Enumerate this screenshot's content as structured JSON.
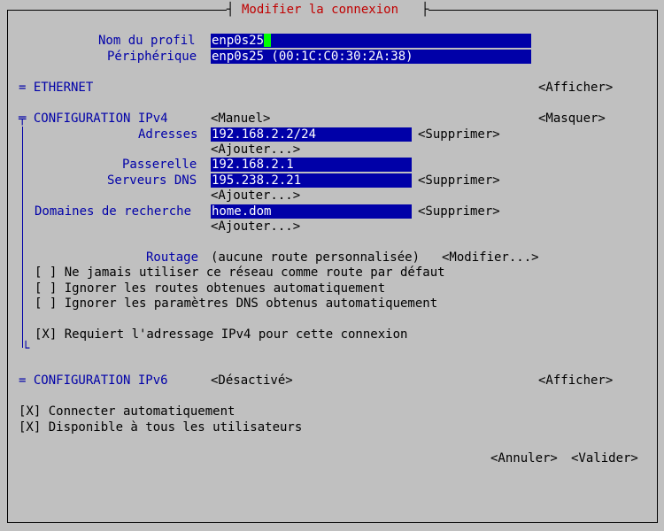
{
  "title": "Modifier la connexion",
  "profile": {
    "label": "Nom du profil",
    "value": "enp0s25"
  },
  "device": {
    "label": "Périphérique",
    "value": "enp0s25 (00:1C:C0:30:2A:38)"
  },
  "ethernet": {
    "header": "= ETHERNET",
    "action": "<Afficher>"
  },
  "ipv4": {
    "header": "╤ CONFIGURATION IPv4",
    "mode": "<Manuel>",
    "action": "<Masquer>",
    "addresses_label": "Adresses",
    "address_value": "192.168.2.2/24",
    "gateway_label": "Passerelle",
    "gateway_value": "192.168.2.1",
    "dns_label": "Serveurs DNS",
    "dns_value": "195.238.2.21",
    "search_label": "Domaines de recherche",
    "search_value": "home.dom",
    "remove": "<Supprimer>",
    "add": "<Ajouter...>",
    "routing_label": "Routage",
    "routing_value": "(aucune route personnalisée)",
    "routing_action": "<Modifier...>",
    "checkbox_never_default": "[ ] Ne jamais utiliser ce réseau comme route par défaut",
    "checkbox_ignore_routes": "[ ] Ignorer les routes obtenues automatiquement",
    "checkbox_ignore_dns": "[ ] Ignorer les paramètres DNS obtenus automatiquement",
    "checkbox_require_ipv4": "[X] Requiert l'adressage IPv4 pour cette connexion"
  },
  "ipv6": {
    "header": "= CONFIGURATION IPv6",
    "mode": "<Désactivé>",
    "action": "<Afficher>"
  },
  "options": {
    "auto_connect": "[X] Connecter automatiquement",
    "all_users": "[X] Disponible à tous les utilisateurs"
  },
  "buttons": {
    "cancel": "<Annuler>",
    "ok": "<Valider>"
  }
}
